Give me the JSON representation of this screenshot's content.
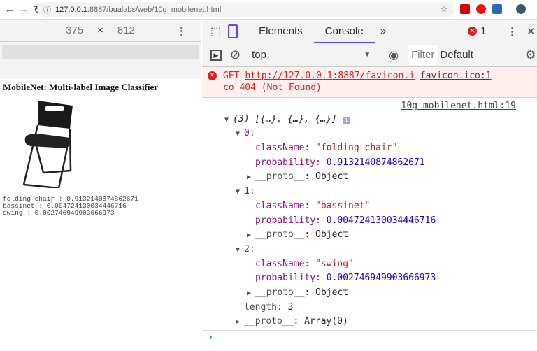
{
  "browser": {
    "url_host": "127.0.0.1",
    "url_path": ":8887/bualabs/web/10g_mobilenet.html"
  },
  "device": {
    "width": "375",
    "x": "×",
    "height": "812"
  },
  "page": {
    "title": "MobileNet: Multi-label Image Classifier",
    "predictions": [
      "folding chair : 0.9132140874862671",
      "bassinet : 0.004724130034446716",
      "swing : 0.002746949903666973"
    ]
  },
  "devtools": {
    "tabs": [
      "Elements",
      "Console"
    ],
    "more": "»",
    "error_count": "1",
    "context": "top",
    "filter_placeholder": "Filter",
    "level": "Default"
  },
  "console": {
    "error_get": "GET ",
    "error_url": "http://127.0.0.1:8887/favicon.i",
    "error_src": "favicon.ico:1",
    "error_tail": "co 404 (Not Found)",
    "source": "10g_mobilenet.html:19",
    "array_summary": "(3) [{…}, {…}, {…}]",
    "items": [
      {
        "index": "0:",
        "className": "\"folding chair\"",
        "probability": "0.9132140874862671"
      },
      {
        "index": "1:",
        "className": "\"bassinet\"",
        "probability": "0.004724130034446716"
      },
      {
        "index": "2:",
        "className": "\"swing\"",
        "probability": "0.002746949903666973"
      }
    ],
    "key_className": "className: ",
    "key_probability": "probability: ",
    "proto": "__proto__",
    "object": ": Object",
    "length_key": "length: ",
    "length_val": "3",
    "array_proto": ": Array(0)"
  }
}
